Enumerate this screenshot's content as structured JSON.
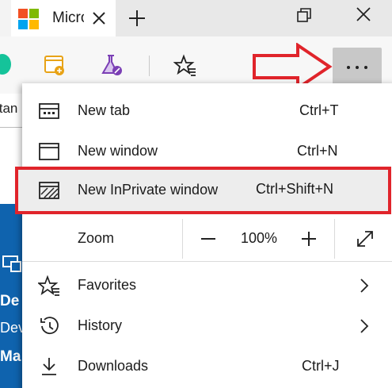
{
  "tab": {
    "title": "Microsoft"
  },
  "page_behind": {
    "text": "ttan",
    "blue_texts": [
      "De",
      "Dev",
      "Ma"
    ]
  },
  "menu": {
    "items": [
      {
        "label": "New tab",
        "shortcut": "Ctrl+T",
        "icon": "new-tab-icon"
      },
      {
        "label": "New window",
        "shortcut": "Ctrl+N",
        "icon": "new-window-icon"
      },
      {
        "label": "New InPrivate window",
        "shortcut": "Ctrl+Shift+N",
        "icon": "inprivate-icon"
      }
    ],
    "zoom": {
      "label": "Zoom",
      "value": "100%"
    },
    "lower_items": [
      {
        "label": "Favorites",
        "icon": "favorites-icon",
        "has_submenu": true
      },
      {
        "label": "History",
        "icon": "history-icon",
        "has_submenu": true
      },
      {
        "label": "Downloads",
        "shortcut": "Ctrl+J",
        "icon": "downloads-icon"
      }
    ]
  },
  "colors": {
    "highlight_border": "#e0242b",
    "annotation_arrow": "#e0242b",
    "more_button_bg": "#c8c8c8"
  }
}
